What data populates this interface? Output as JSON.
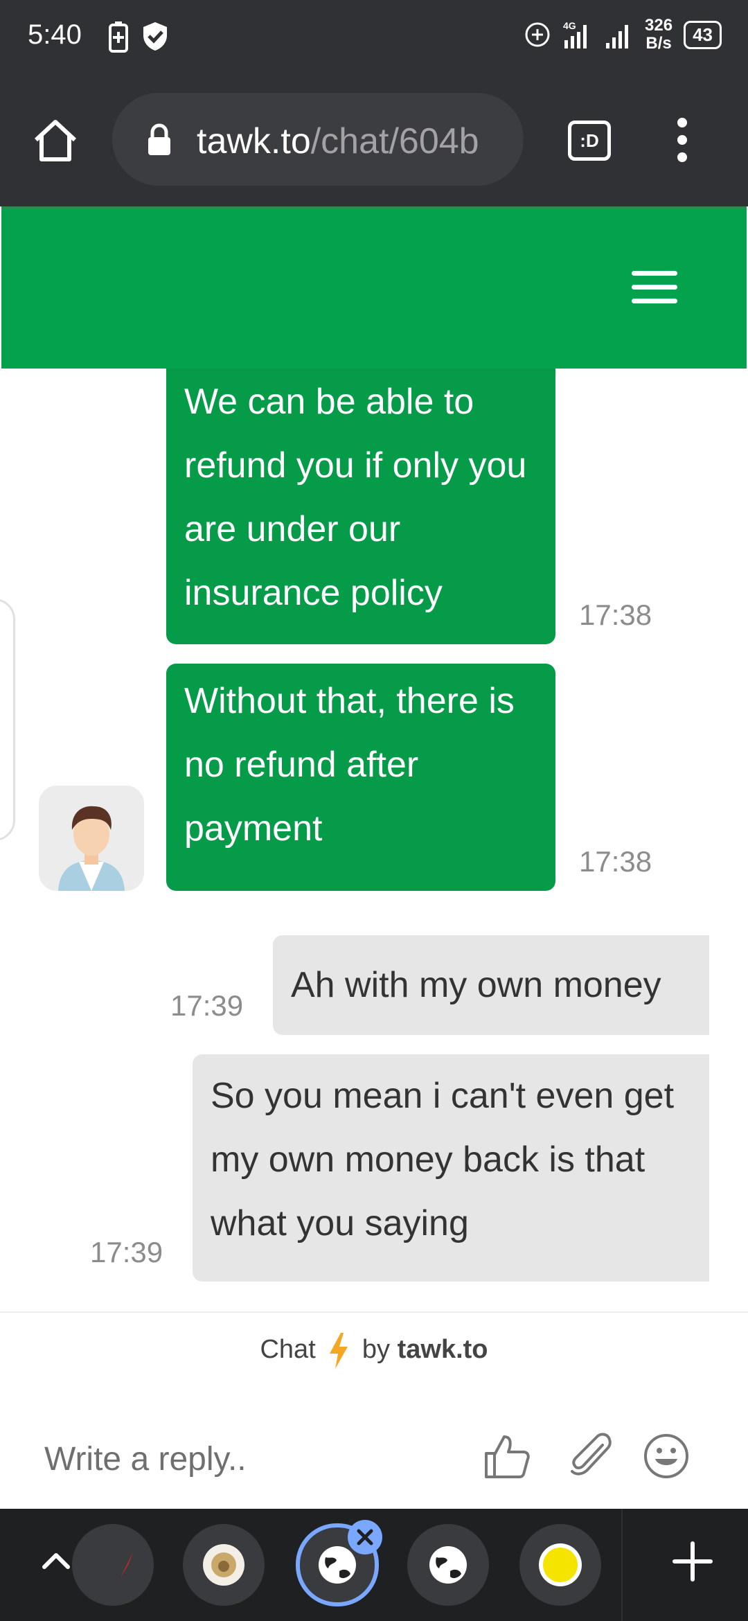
{
  "status_bar": {
    "time": "5:40",
    "network_type": "4G",
    "net_speed_value": "326",
    "net_speed_unit": "B/s",
    "battery_level": "43"
  },
  "browser": {
    "url_domain": "tawk.to",
    "url_path": "/chat/604b",
    "tab_switcher_label": ":D"
  },
  "chat": {
    "messages": [
      {
        "sender": "agent",
        "text": "We can be able to refund you if only you are under our insurance policy",
        "time": "17:38"
      },
      {
        "sender": "agent",
        "text": "Without that, there is no refund after payment",
        "time": "17:38"
      },
      {
        "sender": "visitor",
        "text": "Ah with my own money",
        "time": "17:39"
      },
      {
        "sender": "visitor",
        "text": "So you mean i can't even get my own money back is that what you saying",
        "time": "17:39"
      }
    ],
    "powered_prefix": "Chat",
    "powered_by": "by",
    "powered_brand": "tawk.to",
    "reply_placeholder": "Write a reply..",
    "header_color": "#04a24c",
    "agent_bubble_color": "#069b49",
    "visitor_bubble_color": "#e6e6e6"
  },
  "icons": {
    "reply_bar": [
      "thumbs-up-icon",
      "paperclip-icon",
      "emoji-icon"
    ],
    "tab_strip": [
      "chevron-up-icon",
      "globe-icon",
      "plus-icon"
    ]
  }
}
